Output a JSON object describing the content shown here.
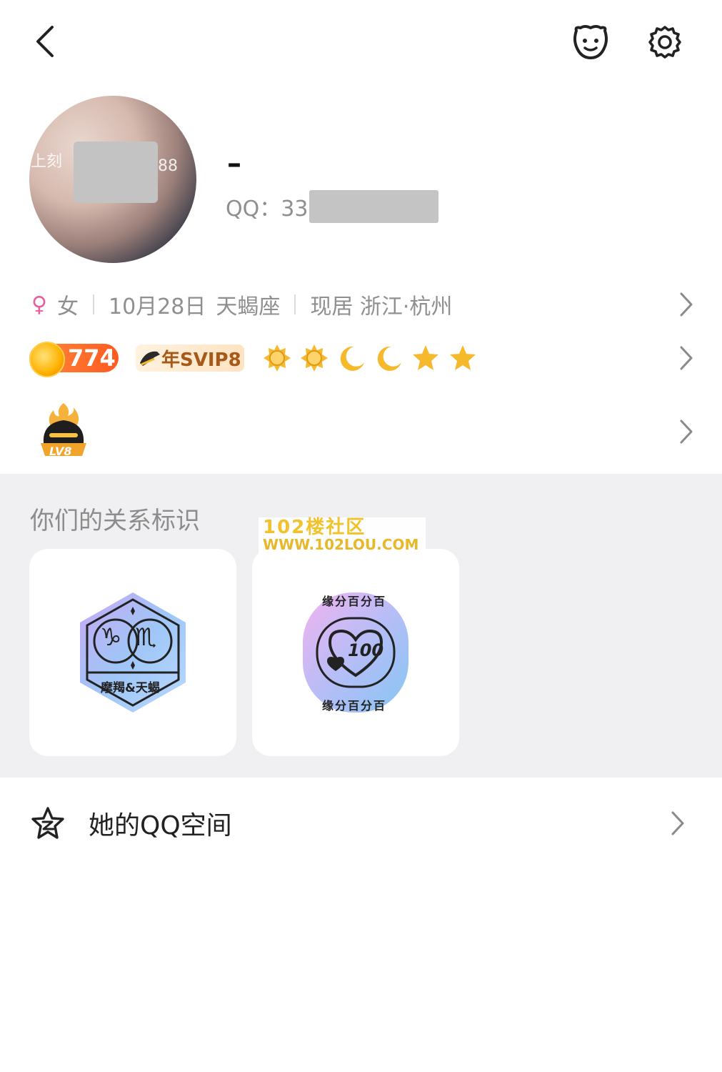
{
  "header": {
    "back_icon": "chevron-left-icon",
    "actions": [
      "avatar-face-icon",
      "gear-icon"
    ]
  },
  "profile": {
    "avatar_overlay_left": "上刻",
    "avatar_overlay_right": "88",
    "nickname": "–",
    "qq_label": "QQ：33"
  },
  "info": {
    "gender_symbol": "♀",
    "gender": "女",
    "birthday": "10月28日",
    "zodiac": "天蝎座",
    "location": "现居 浙江·杭州"
  },
  "badges": {
    "level_value": "774",
    "svip_label": "年SVIP8",
    "level_icons": [
      "sun",
      "sun",
      "moon",
      "moon",
      "star",
      "star"
    ]
  },
  "game": {
    "badge_label": "LV8"
  },
  "relationship": {
    "title": "你们的关系标识",
    "cards": [
      {
        "symbol_left": "♑",
        "symbol_right": "♏",
        "caption": "摩羯&天蝎"
      },
      {
        "ring_top": "缘分百分百",
        "ring_bottom": "缘分百分百",
        "number": "100"
      }
    ]
  },
  "watermark": {
    "line1": "102楼社区",
    "line2": "WWW.102LOU.COM"
  },
  "qzone": {
    "label": "她的QQ空间"
  },
  "colors": {
    "accent_orange": "#ff5a1f",
    "gold": "#f5b82e",
    "gray_bg": "#f0f0f2",
    "text_muted": "#8f8f8f",
    "gender_pink": "#e85ea0"
  }
}
